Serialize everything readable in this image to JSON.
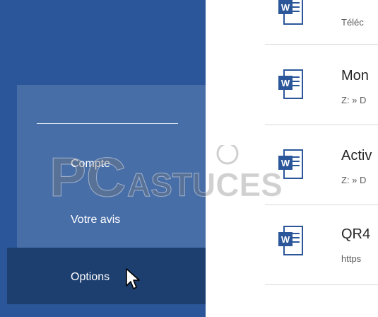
{
  "sidebar": {
    "items": [
      {
        "label": "Compte"
      },
      {
        "label": "Votre avis"
      },
      {
        "label": "Options"
      }
    ],
    "accent_color": "#2b579a",
    "selected_color": "#1d3f70"
  },
  "recent": {
    "documents": [
      {
        "title": "",
        "path": "Téléc",
        "icon": "word-document-icon"
      },
      {
        "title": "Mon",
        "path": "Z: » D",
        "icon": "word-document-icon"
      },
      {
        "title": "Activ",
        "path": "Z: » D",
        "icon": "word-document-icon"
      },
      {
        "title": "QR4",
        "path": "https",
        "icon": "word-document-icon"
      }
    ]
  },
  "watermark": {
    "text_big": "PC",
    "text_small": "ASTUCES"
  }
}
